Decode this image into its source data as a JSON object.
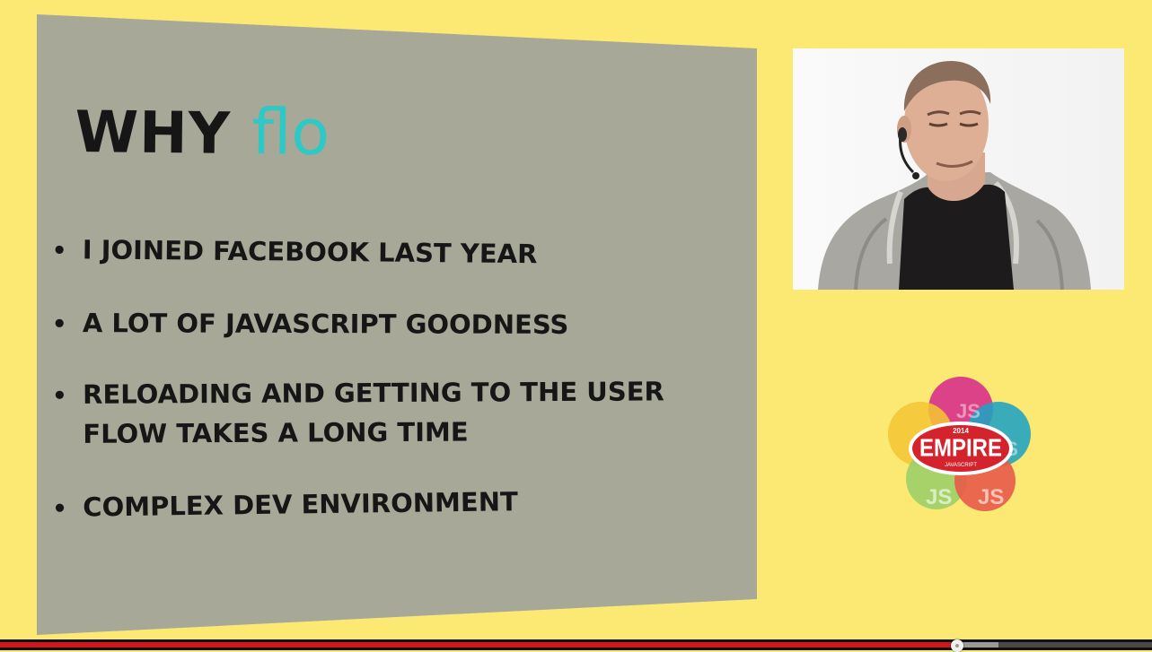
{
  "slide": {
    "title_prefix": "WHY",
    "title_accent": "flo",
    "bullet_symbol": "•",
    "bullets": [
      [
        "I JOINED FACEBOOK LAST YEAR"
      ],
      [
        "A LOT OF JAVASCRIPT GOODNESS"
      ],
      [
        "RELOADING AND GETTING TO THE USER",
        "FLOW TAKES A LONG TIME"
      ],
      [
        "COMPLEX DEV ENVIRONMENT"
      ]
    ]
  },
  "logo": {
    "year": "2014",
    "name": "EMPIRE",
    "tagline": "JAVASCRIPT",
    "petal_text": "JS"
  },
  "player": {
    "progress_fraction": 0.831,
    "buffered_fraction": 0.867
  },
  "colors": {
    "background": "#fbe973",
    "slide_panel": "#a8a898",
    "accent_teal": "#2ec8c6",
    "text_dark": "#161616",
    "progress_red": "#cc181e",
    "logo_red": "#d4232d",
    "petal_magenta": "#d9338a",
    "petal_blue": "#1fa3c3",
    "petal_yellow": "#f4c534",
    "petal_green": "#9ccf68",
    "petal_red": "#e85a49"
  }
}
